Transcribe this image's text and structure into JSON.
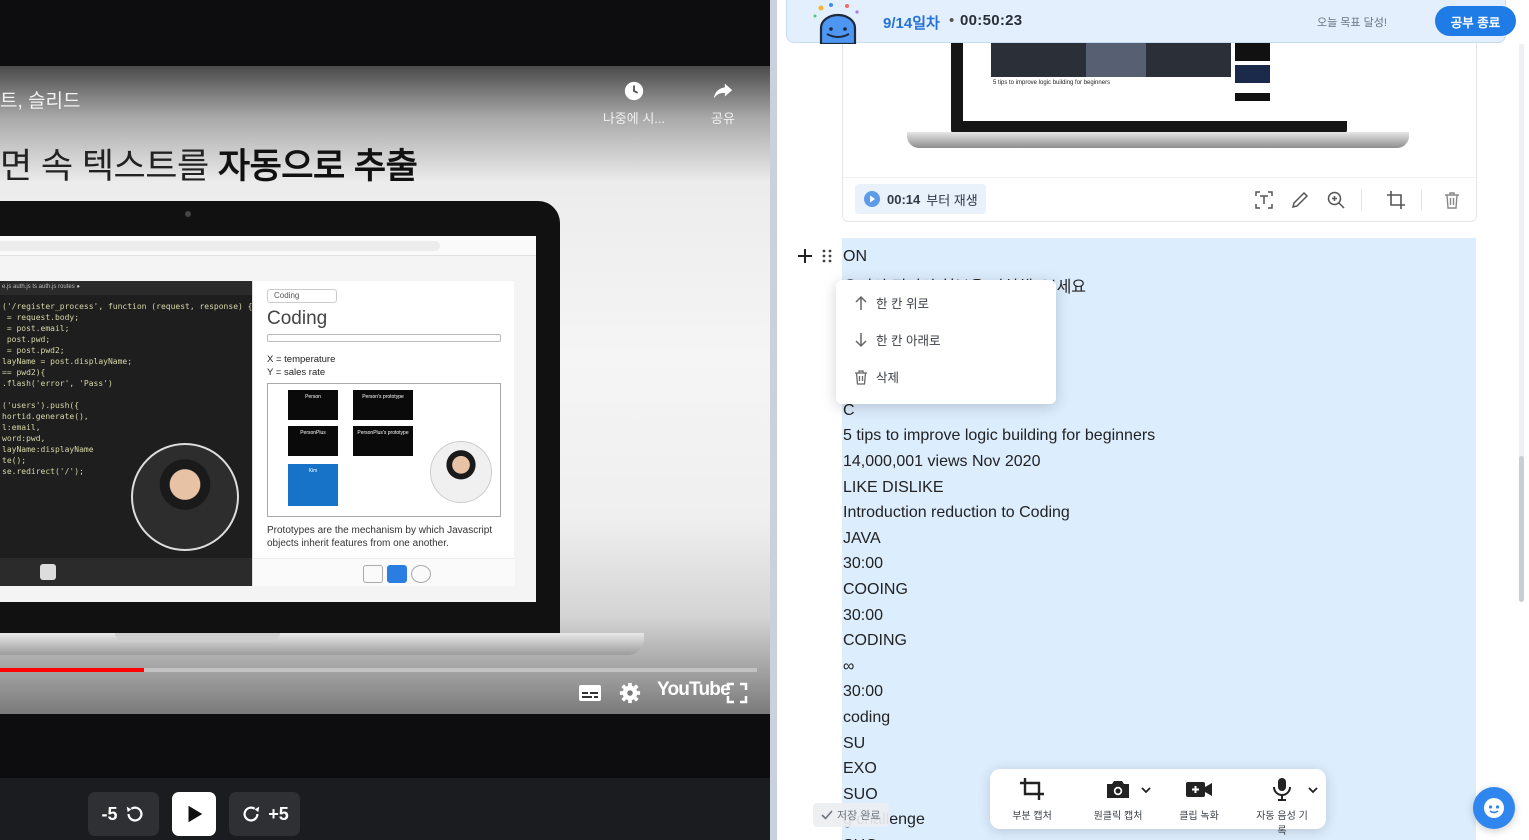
{
  "video": {
    "title": "트, 슬리드",
    "slide_heading_light": "면 속 텍스트를 ",
    "slide_heading_bold": "자동으로 추출",
    "watch_later_label": "나중에 시...",
    "share_label": "공유",
    "youtube_logo": "YouTube",
    "progress": 0.19,
    "inner": {
      "code_tabs": "e.js      auth.js  ts      auth.js  routes  ●",
      "code_lines": [
        "('/register_process', function (request, response) {",
        " = request.body;",
        " = post.email;",
        " post.pwd;",
        " = post.pwd2;",
        "layName = post.displayName;",
        "== pwd2){",
        ".flash('error', 'Pass')",
        "",
        "('users').push({",
        "hortid.generate(),",
        "l:email,",
        "word:pwd,",
        "layName:displayName",
        "te();",
        "se.redirect('/');"
      ],
      "doc_chip": "Coding",
      "doc_title": "Coding",
      "doc_x": "X = temperature",
      "doc_y": "Y = sales rate",
      "fig_boxes": [
        "Person",
        "Person's prototype",
        "PersonPlus",
        "PersonPlus's prototype",
        "Kim"
      ],
      "doc_caption": "Prototypes are the mechanism by which Javascript objects inherit features from one another."
    }
  },
  "player": {
    "rewind_label": "-5",
    "forward_label": "+5"
  },
  "header": {
    "date": "9/14일차",
    "separator": "•",
    "timer": "00:50:23",
    "goal_text": "오늘 목표 달성!",
    "end_button": "공부 종료"
  },
  "capture_card": {
    "thumb_caption": "5 tips to improve logic building for beginners",
    "replay_time": "00:14",
    "replay_suffix": "부터 재생",
    "toolbar_icons": [
      "text-extract-icon",
      "pen-icon",
      "zoom-icon",
      "crop-icon",
      "trash-icon"
    ]
  },
  "ocr_block": {
    "lines": [
      "ON",
      "우리의 전지의 천부을 거처해! 보세요",
      "C",
      "5 tips to improve logic building for beginners",
      "14,000,001 views Nov 2020",
      "LIKE DISLIKE",
      "Introduction reduction to Coding",
      "JAVA",
      "30:00",
      "COOING",
      "30:00",
      "CODING",
      "∞",
      "30:00",
      "coding",
      "SU",
      "EXO",
      "SUO",
      "g challenge",
      "SUO"
    ]
  },
  "context_menu": {
    "items": [
      {
        "label": "한 칸 위로",
        "icon": "arrow-up-icon"
      },
      {
        "label": "한 칸 아래로",
        "icon": "arrow-down-icon"
      },
      {
        "label": "삭제",
        "icon": "trash-icon"
      }
    ]
  },
  "saved_toast": "저장 완료",
  "capture_bar": {
    "items": [
      {
        "label": "부분 캡처",
        "icon": "crop-icon"
      },
      {
        "label": "원클릭 캡처",
        "icon": "camera-icon"
      },
      {
        "label": "클립 녹화",
        "icon": "video-camera-icon"
      },
      {
        "label": "자동 음성 기록",
        "icon": "microphone-icon"
      }
    ]
  },
  "colors": {
    "accent": "#1f7be6",
    "ocr_highlight": "#dcedfd",
    "header_bg": "#e3effd",
    "progress": "#ff0000"
  }
}
